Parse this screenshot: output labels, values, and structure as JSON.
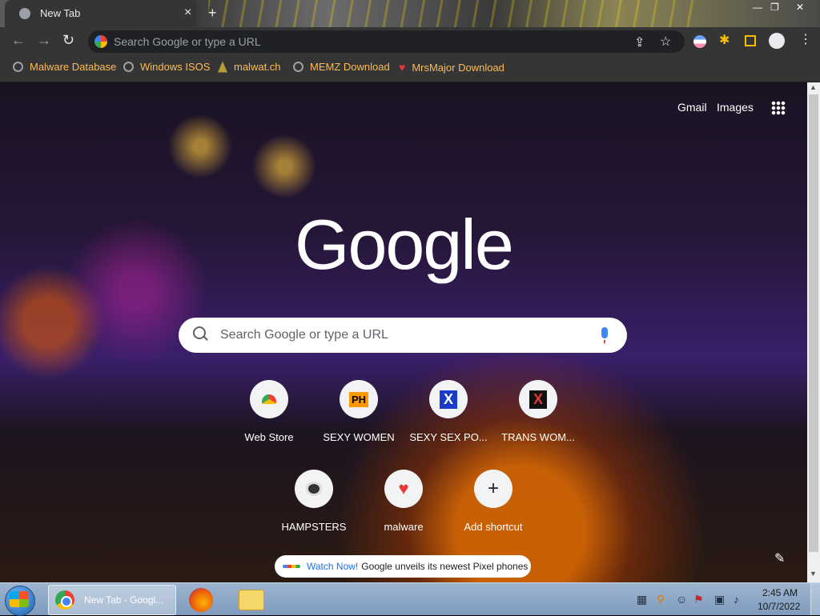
{
  "browser": {
    "tab_title": "New Tab",
    "omnibox_placeholder": "Search Google or type a URL"
  },
  "bookmarks": [
    {
      "label": "Malware Database",
      "icon": "globe-icon"
    },
    {
      "label": "Windows ISOS",
      "icon": "globe-icon"
    },
    {
      "label": "malwat.ch",
      "icon": "arch-icon"
    },
    {
      "label": "MEMZ Download",
      "icon": "globe-icon"
    },
    {
      "label": "MrsMajor Download",
      "icon": "heart-icon"
    }
  ],
  "ntp": {
    "gmail": "Gmail",
    "images": "Images",
    "logo": "Google",
    "search_placeholder": "Search Google or type a URL",
    "shortcuts": [
      {
        "label": "Web Store",
        "glyph": ""
      },
      {
        "label": "SEXY WOMEN",
        "glyph": "PH"
      },
      {
        "label": "SEXY SEX PO...",
        "glyph": "X"
      },
      {
        "label": "TRANS WOM...",
        "glyph": "X"
      },
      {
        "label": "HAMPSTERS",
        "glyph": ""
      },
      {
        "label": "malware",
        "glyph": "♥"
      },
      {
        "label": "Add shortcut",
        "glyph": "+"
      }
    ],
    "watch_link": "Watch Now!",
    "watch_text": "Google unveils its newest Pixel phones"
  },
  "taskbar": {
    "chrome_label": "New Tab - Googl...",
    "time": "2:45 AM",
    "date": "10/7/2022"
  },
  "colors": {
    "bookmark_text": "#fbbc55",
    "chrome_dark": "#353535",
    "taskbar": "#8aa6c6"
  }
}
